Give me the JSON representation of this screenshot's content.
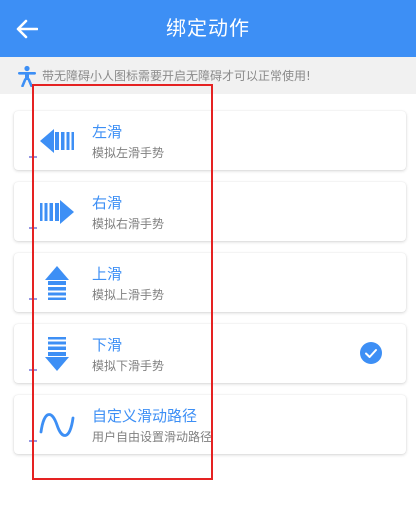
{
  "header": {
    "title": "绑定动作",
    "back_icon": "arrow-left-icon"
  },
  "notice": {
    "icon": "accessibility-person-icon",
    "text": "带无障碍小人图标需要开启无障碍才可以正常使用!"
  },
  "actions": [
    {
      "title": "左滑",
      "subtitle": "模拟左滑手势",
      "icon": "swipe-left-icon",
      "selected": false
    },
    {
      "title": "右滑",
      "subtitle": "模拟右滑手势",
      "icon": "swipe-right-icon",
      "selected": false
    },
    {
      "title": "上滑",
      "subtitle": "模拟上滑手势",
      "icon": "swipe-up-icon",
      "selected": false
    },
    {
      "title": "下滑",
      "subtitle": "模拟下滑手势",
      "icon": "swipe-down-icon",
      "selected": true
    },
    {
      "title": "自定义滑动路径",
      "subtitle": "用户自由设置滑动路径",
      "icon": "custom-path-icon",
      "selected": false
    }
  ],
  "colors": {
    "primary": "#3d8ff5",
    "highlight": "#e52222",
    "notice_bg": "#f1f1f1"
  }
}
